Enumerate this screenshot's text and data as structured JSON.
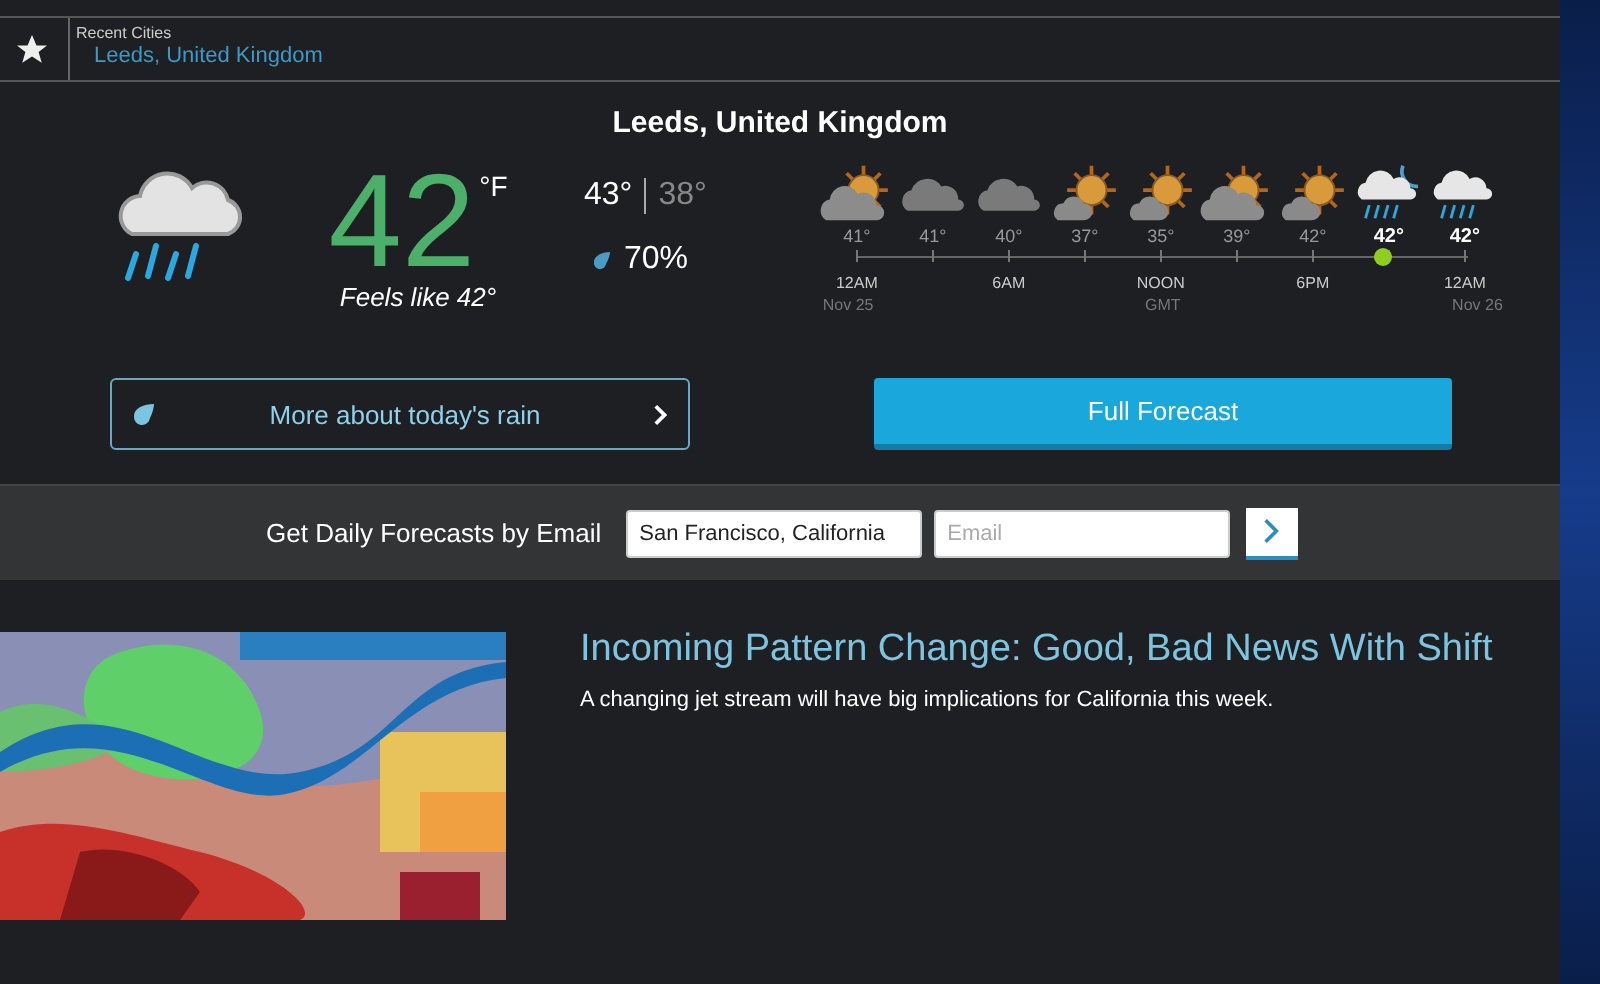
{
  "recent_cities": {
    "label": "Recent Cities",
    "items": [
      "Leeds, United Kingdom"
    ]
  },
  "location": "Leeds, United Kingdom",
  "current": {
    "temperature": "42",
    "unit": "°F",
    "feels_like": "Feels like 42°",
    "high": "43°",
    "low": "38°",
    "precipitation": "70%"
  },
  "hourly": [
    {
      "kind": "partly-cloudy",
      "temp": "41°",
      "highlighted": false,
      "now": false,
      "time": "12AM"
    },
    {
      "kind": "cloudy",
      "temp": "41°",
      "highlighted": false,
      "now": false
    },
    {
      "kind": "cloudy",
      "temp": "40°",
      "highlighted": false,
      "now": false,
      "time": "6AM"
    },
    {
      "kind": "sun-cloud",
      "temp": "37°",
      "highlighted": false,
      "now": false
    },
    {
      "kind": "sun-cloud",
      "temp": "35°",
      "highlighted": false,
      "now": false,
      "time": "NOON"
    },
    {
      "kind": "partly-cloudy",
      "temp": "39°",
      "highlighted": false,
      "now": false
    },
    {
      "kind": "sun-cloud",
      "temp": "42°",
      "highlighted": false,
      "now": false,
      "time": "6PM"
    },
    {
      "kind": "rain-night",
      "temp": "42°",
      "highlighted": true,
      "now": true
    },
    {
      "kind": "rain",
      "temp": "42°",
      "highlighted": true,
      "now": false,
      "time": "12AM"
    }
  ],
  "hourly_dates": [
    "Nov 25",
    "GMT",
    "Nov 26"
  ],
  "buttons": {
    "rain": "More about today's rain",
    "forecast": "Full Forecast"
  },
  "email_signup": {
    "label": "Get Daily Forecasts by Email",
    "location_value": "San Francisco, California",
    "email_placeholder": "Email"
  },
  "article": {
    "title": "Incoming Pattern Change: Good, Bad News With Shift",
    "summary": "A changing jet stream will have big implications for California this week."
  }
}
